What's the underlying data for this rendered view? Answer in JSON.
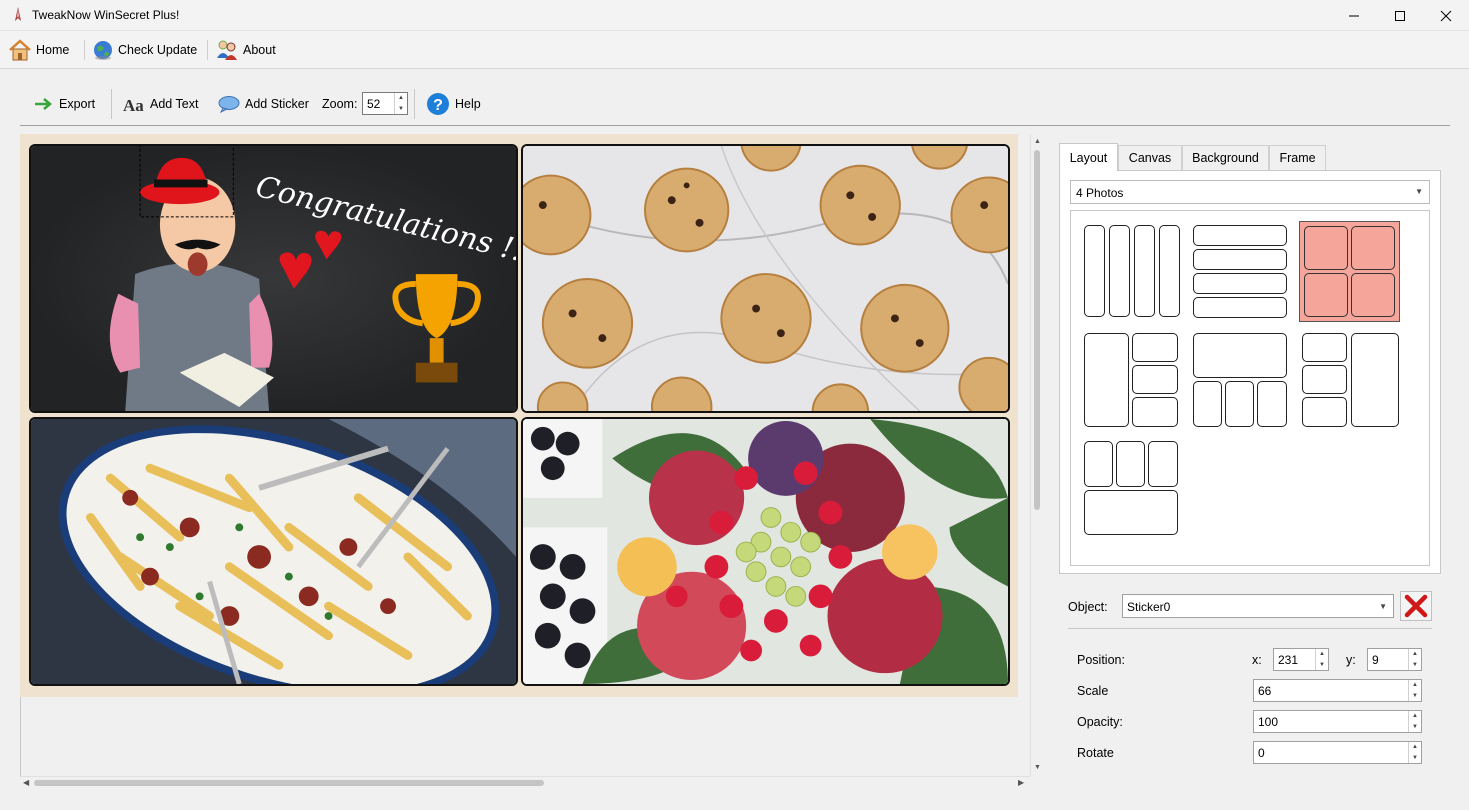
{
  "window": {
    "title": "TweakNow WinSecret Plus!"
  },
  "menu": {
    "home": "Home",
    "check_update": "Check Update",
    "about": "About"
  },
  "toolbar": {
    "export": "Export",
    "add_text": "Add Text",
    "add_sticker": "Add Sticker",
    "zoom_label": "Zoom:",
    "zoom_value": "52",
    "help": "Help"
  },
  "collage": {
    "congrats_text": "Congratulations !!!"
  },
  "panel": {
    "tabs": [
      "Layout",
      "Canvas",
      "Background",
      "Frame"
    ],
    "active_tab": "Layout",
    "layout_select": "4 Photos",
    "object_label": "Object:",
    "object_value": "Sticker0",
    "position_label": "Position:",
    "x_label": "x:",
    "x_value": "231",
    "y_label": "y:",
    "y_value": "9",
    "scale_label": "Scale",
    "scale_value": "66",
    "opacity_label": "Opacity:",
    "opacity_value": "100",
    "rotate_label": "Rotate",
    "rotate_value": "0"
  },
  "colors": {
    "selected_layout": "#f5a59a",
    "collage_bg": "#efe3cf"
  }
}
